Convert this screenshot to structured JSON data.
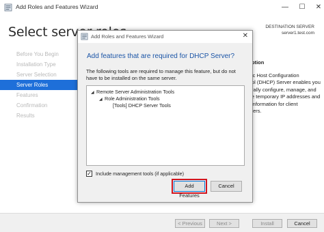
{
  "main_window": {
    "title": "Add Roles and Features Wizard",
    "heading": "Select server roles",
    "destination_label": "DESTINATION SERVER",
    "destination_server": "server1.test.com",
    "nav": [
      {
        "label": "Before You Begin",
        "active": false
      },
      {
        "label": "Installation Type",
        "active": false
      },
      {
        "label": "Server Selection",
        "active": false
      },
      {
        "label": "Server Roles",
        "active": true
      },
      {
        "label": "Features",
        "active": false
      },
      {
        "label": "Confirmation",
        "active": false
      },
      {
        "label": "Results",
        "active": false
      }
    ],
    "description": {
      "heading": "ption",
      "lines": [
        "ic Host Configuration",
        "ol (DHCP) Server enables you",
        "rally configure, manage, and",
        "e temporary IP addresses and",
        " information for client",
        "ters."
      ]
    },
    "footer": {
      "previous": "< Previous",
      "next": "Next >",
      "install": "Install",
      "cancel": "Cancel"
    },
    "window_controls": {
      "minimize": "—",
      "maximize": "☐",
      "close": "✕"
    }
  },
  "dialog": {
    "title": "Add Roles and Features Wizard",
    "close": "✕",
    "heading": "Add features that are required for DHCP Server?",
    "description": "The following tools are required to manage this feature, but do not have to be installed on the same server.",
    "tree": [
      {
        "label": "Remote Server Administration Tools",
        "level": 0,
        "expanded": true
      },
      {
        "label": "Role Administration Tools",
        "level": 1,
        "expanded": true
      },
      {
        "label": "[Tools] DHCP Server Tools",
        "level": 2,
        "expanded": false
      }
    ],
    "include_tools_label": "Include management tools (if applicable)",
    "include_tools_checked": true,
    "add_features": "Add Features",
    "cancel": "Cancel",
    "highlight_color": "#d0141e"
  },
  "colors": {
    "accent": "#1e6fd9",
    "heading_blue": "#1a54a6"
  }
}
